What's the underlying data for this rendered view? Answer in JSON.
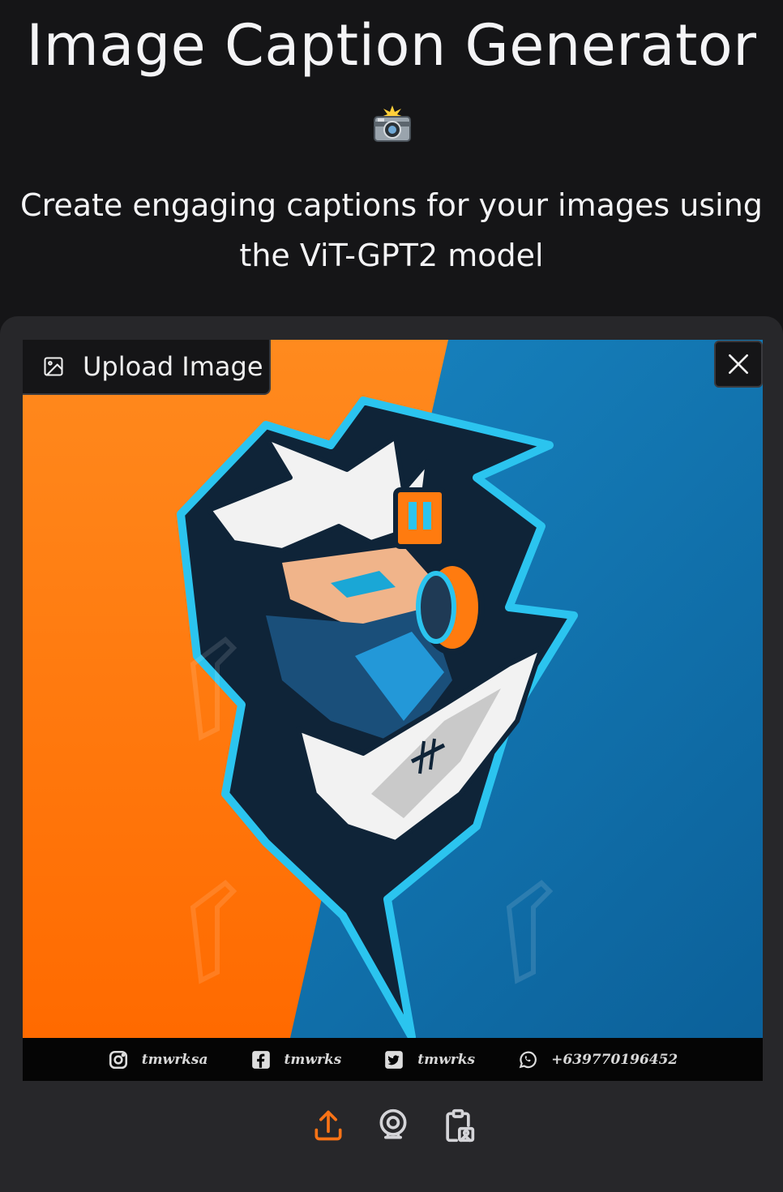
{
  "header": {
    "title": "Image Caption Generator",
    "emoji_icon": "camera-with-flash-icon",
    "subtitle": "Create engaging captions for your images using the ViT-GPT2 model"
  },
  "image_input": {
    "label": "Upload Image",
    "label_icon": "image-icon",
    "clear_icon": "close-icon",
    "preview_description_icon": "esports-mascot-image",
    "social_bar": {
      "instagram": "tmwrksa",
      "facebook": "tmwrks",
      "twitter": "tmwrks",
      "whatsapp": "+639770196452"
    },
    "sources": [
      "upload-icon",
      "webcam-icon",
      "clipboard-icon"
    ]
  },
  "colors": {
    "background": "#151517",
    "panel": "#27272a",
    "accent_orange": "#f97316",
    "image_orange": "#ff7b0f",
    "image_blue": "#0e74b3"
  }
}
